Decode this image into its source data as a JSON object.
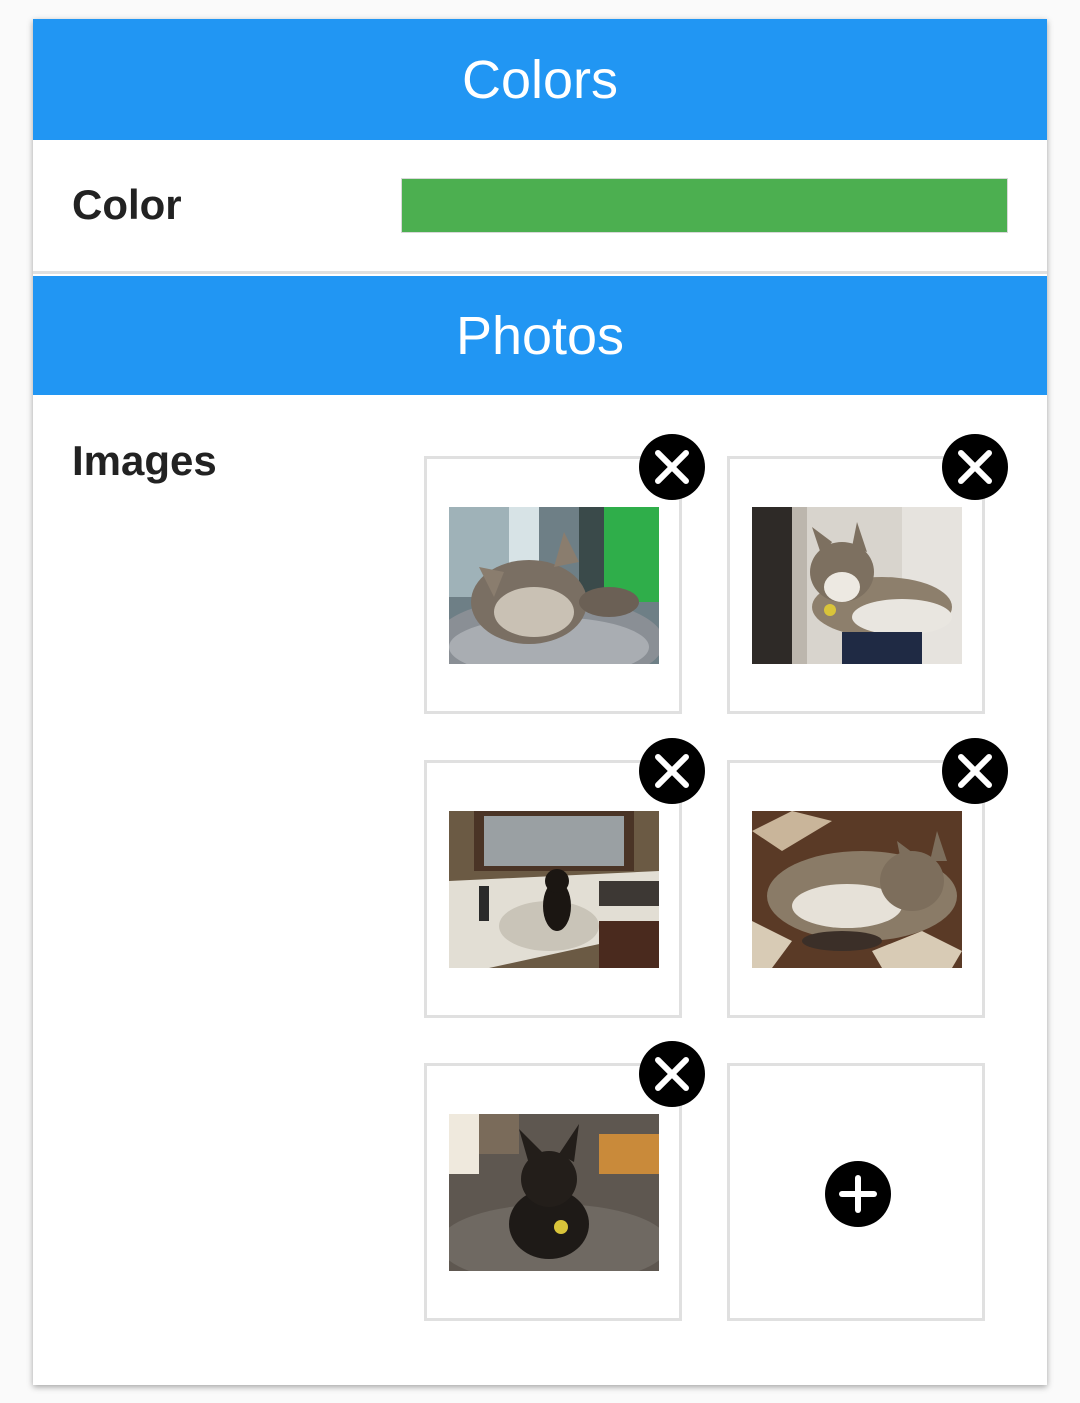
{
  "theme": {
    "header_color": "#2196f3",
    "selected_color": "#4caf50"
  },
  "colors_section": {
    "title": "Colors",
    "color_label": "Color"
  },
  "photos_section": {
    "title": "Photos",
    "images_label": "Images",
    "photos": [
      {
        "name": "cat-sleeping-bed",
        "remove_icon": "close-circle-icon"
      },
      {
        "name": "cat-in-box",
        "remove_icon": "close-circle-icon"
      },
      {
        "name": "cat-in-sink",
        "remove_icon": "close-circle-icon"
      },
      {
        "name": "cat-on-blanket",
        "remove_icon": "close-circle-icon"
      },
      {
        "name": "black-cat-on-bed",
        "remove_icon": "close-circle-icon"
      }
    ],
    "add_icon": "add-circle-icon"
  }
}
